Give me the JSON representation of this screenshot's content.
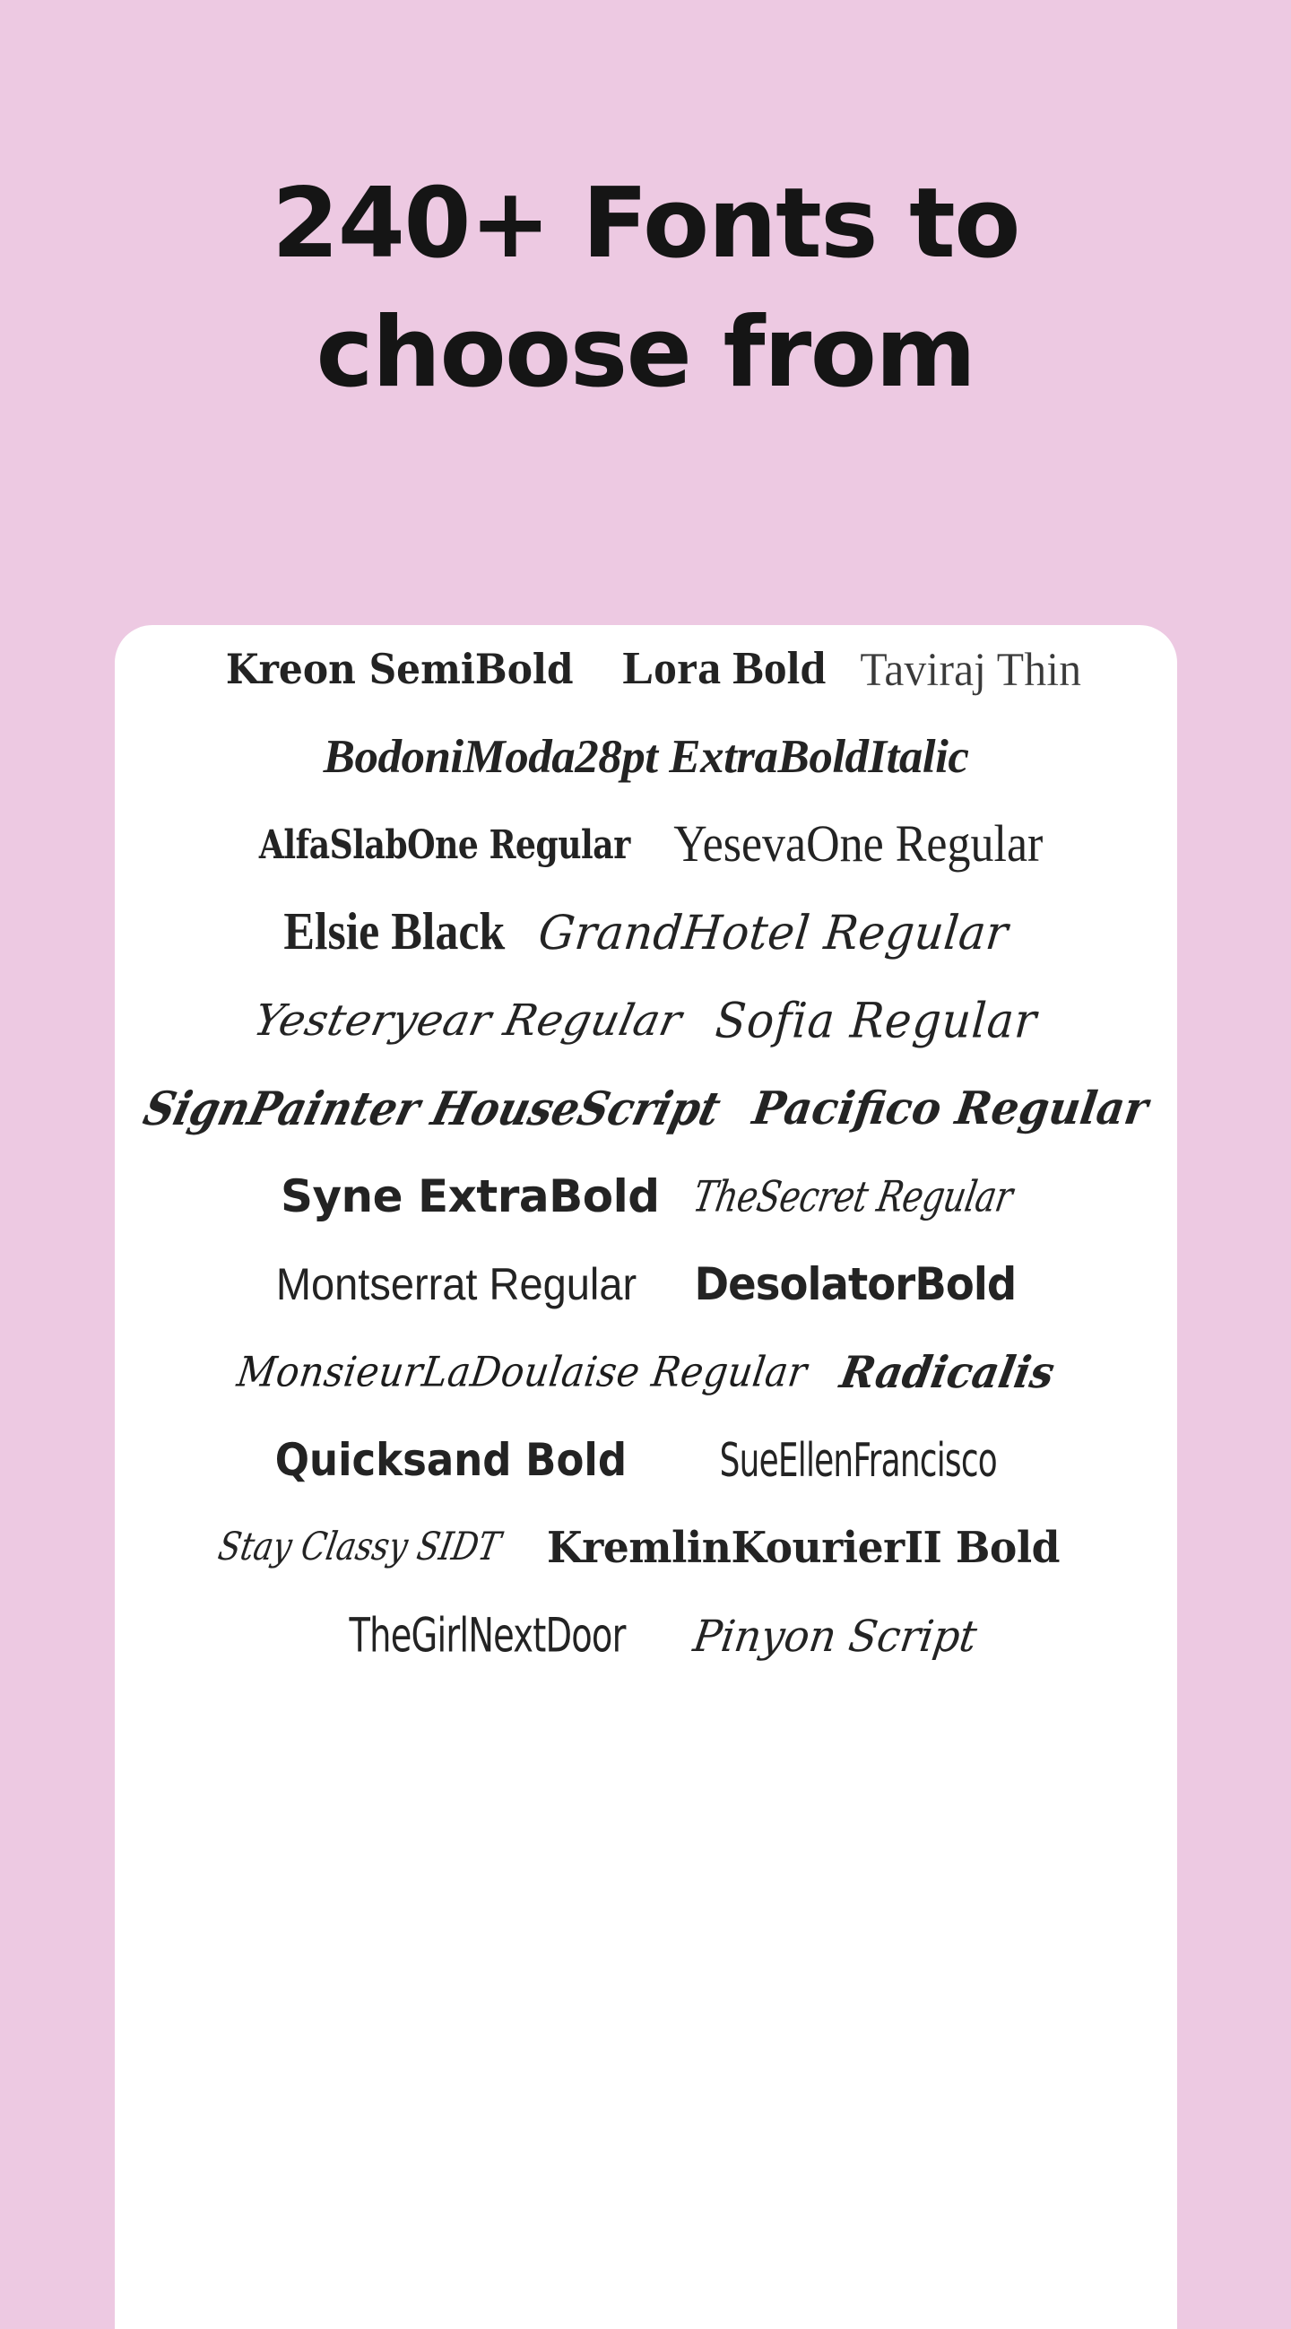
{
  "theme": {
    "background_color": "#edc9e2",
    "card_color": "#ffffff",
    "heading_color": "#151515",
    "sample_color": "#232323"
  },
  "hero": {
    "title": "240+ Fonts to\nchoose from"
  },
  "fonts_card": {
    "rows": [
      {
        "items": [
          {
            "label": "Kreon SemiBold",
            "style_class": "s-kreon"
          },
          {
            "label": "Lora Bold",
            "style_class": "s-lora"
          },
          {
            "label": "Taviraj Thin",
            "style_class": "s-taviraj"
          }
        ]
      },
      {
        "items": [
          {
            "label": "BodoniModa28pt ExtraBoldItalic",
            "style_class": "s-bodoni"
          }
        ]
      },
      {
        "items": [
          {
            "label": "AlfaSlabOne Regular",
            "style_class": "s-alfaslab"
          },
          {
            "label": "YesevaOne Regular",
            "style_class": "s-yeseva"
          }
        ]
      },
      {
        "items": [
          {
            "label": "Elsie Black",
            "style_class": "s-elsie"
          },
          {
            "label": "GrandHotel Regular",
            "style_class": "s-grandhotel"
          }
        ]
      },
      {
        "items": [
          {
            "label": "Yesteryear Regular",
            "style_class": "s-yesteryear"
          },
          {
            "label": "Sofia Regular",
            "style_class": "s-sofia"
          }
        ]
      },
      {
        "items": [
          {
            "label": "SignPainter HouseScript",
            "style_class": "s-signpainter"
          },
          {
            "label": "Pacifico Regular",
            "style_class": "s-pacifico"
          }
        ]
      },
      {
        "items": [
          {
            "label": "Syne ExtraBold",
            "style_class": "s-syne"
          },
          {
            "label": "TheSecret Regular",
            "style_class": "s-thesecret"
          }
        ]
      },
      {
        "items": [
          {
            "label": "Montserrat Regular",
            "style_class": "s-montserrat"
          },
          {
            "label": "DesolatorBold",
            "style_class": "s-desolator"
          }
        ]
      },
      {
        "items": [
          {
            "label": "MonsieurLaDoulaise Regular",
            "style_class": "s-monsieur"
          },
          {
            "label": "Radicalis",
            "style_class": "s-radicalis"
          }
        ]
      },
      {
        "items": [
          {
            "label": "Quicksand Bold",
            "style_class": "s-quicksand"
          },
          {
            "label": "SueEllenFrancisco",
            "style_class": "s-sueellen"
          }
        ]
      },
      {
        "items": [
          {
            "label": "Stay Classy SIDT",
            "style_class": "s-stayclassy"
          },
          {
            "label": "KremlinKourierII Bold",
            "style_class": "s-kremlin"
          }
        ]
      },
      {
        "items": [
          {
            "label": "TheGirlNextDoor",
            "style_class": "s-girlnextdoor"
          },
          {
            "label": "Pinyon Script",
            "style_class": "s-pinyon"
          }
        ]
      }
    ]
  }
}
